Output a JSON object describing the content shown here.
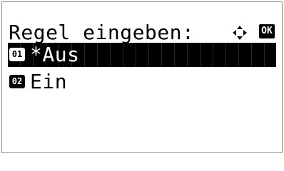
{
  "header": {
    "title": "Regel eingeben:",
    "nav_icon": "four-way-arrow-icon",
    "ok_label": "OK"
  },
  "menu": {
    "items": [
      {
        "number": "01",
        "label": "*Aus",
        "selected": true
      },
      {
        "number": "02",
        "label": "Ein",
        "selected": false
      }
    ]
  }
}
